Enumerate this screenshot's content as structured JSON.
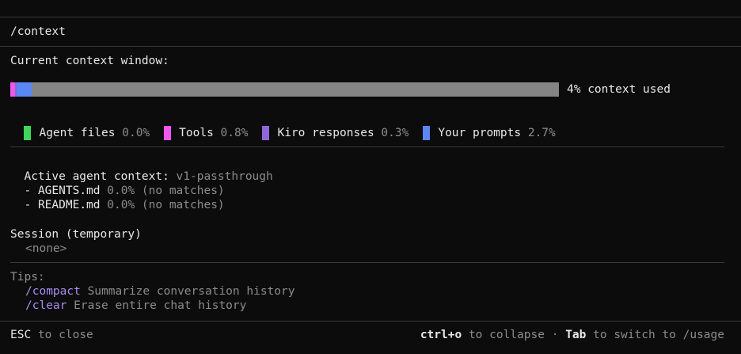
{
  "command": "/context",
  "current_window_label": "Current context window:",
  "usage": {
    "percent_used": 4,
    "used_label": "4% context used",
    "segments": [
      {
        "name": "agent-files",
        "fraction": 0.0,
        "color": "#3fd65a"
      },
      {
        "name": "tools",
        "fraction": 0.008,
        "color": "#ef57ef"
      },
      {
        "name": "kiro-responses",
        "fraction": 0.003,
        "color": "#8f67d9"
      },
      {
        "name": "your-prompts",
        "fraction": 0.027,
        "color": "#5b86f5"
      }
    ]
  },
  "legend": [
    {
      "label": "Agent files",
      "value": "0.0%",
      "color": "#3fd65a"
    },
    {
      "label": "Tools",
      "value": "0.8%",
      "color": "#ef57ef"
    },
    {
      "label": "Kiro responses",
      "value": "0.3%",
      "color": "#8f67d9"
    },
    {
      "label": "Your prompts",
      "value": "2.7%",
      "color": "#5b86f5"
    }
  ],
  "agent_context": {
    "label": "Active agent context:",
    "name": "v1-passthrough",
    "files": [
      {
        "bullet": "-",
        "name": "AGENTS.md",
        "value": "0.0%",
        "note": "(no matches)"
      },
      {
        "bullet": "-",
        "name": "README.md",
        "value": "0.0%",
        "note": "(no matches)"
      }
    ]
  },
  "session": {
    "label": "Session (temporary)",
    "value": "<none>"
  },
  "tips": {
    "label": "Tips:",
    "items": [
      {
        "command": "/compact",
        "description": "Summarize conversation history"
      },
      {
        "command": "/clear",
        "description": "Erase entire chat history"
      }
    ]
  },
  "footer": {
    "esc_key": "ESC",
    "esc_text": "to close",
    "collapse_key": "ctrl+o",
    "collapse_text": "to collapse",
    "separator": "·",
    "tab_key": "Tab",
    "tab_text": "to switch to /usage"
  }
}
